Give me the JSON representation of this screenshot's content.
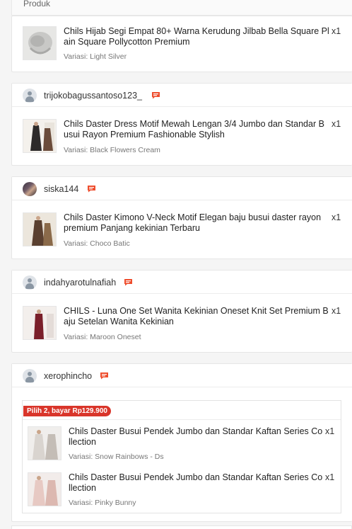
{
  "header": {
    "label": "Produk"
  },
  "orders": [
    {
      "products": [
        {
          "name_line1": "Chils Hijab Segi Empat 80+ Warna Kerudung Jilbab Bella Square Pl",
          "name_line2": "ain Square Pollycotton Premium",
          "qty": "x1",
          "variant": "Variasi: Light Silver"
        }
      ]
    },
    {
      "username": "trijokobagussantoso123_",
      "products": [
        {
          "name_line1": "Chils Daster Dress Motif Mewah Lengan 3/4 Jumbo dan Standar B",
          "name_line2": "usui Rayon Premium Fashionable Stylish",
          "qty": "x1",
          "variant": "Variasi: Black Flowers Cream"
        }
      ]
    },
    {
      "username": "siska144",
      "products": [
        {
          "name_line1": "Chils Daster Kimono V-Neck Motif Elegan baju busui daster rayon",
          "name_line2": "premium Panjang kekinian Terbaru",
          "qty": "x1",
          "variant": "Variasi: Choco Batic"
        }
      ]
    },
    {
      "username": "indahyarotulnafiah",
      "products": [
        {
          "name_line1": "CHILS - Luna One Set Wanita Kekinian Oneset Knit Set Premium B",
          "name_line2": "aju Setelan Wanita Kekinian",
          "qty": "x1",
          "variant": "Variasi: Maroon Oneset"
        }
      ]
    },
    {
      "username": "xerophincho",
      "bundle_label": "Pilih 2, bayar Rp129.900",
      "products": [
        {
          "name_line1": "Chils Daster Busui Pendek Jumbo dan Standar Kaftan Series Co",
          "name_line2": "llection",
          "qty": "x1",
          "variant": "Variasi: Snow Rainbows - Ds"
        },
        {
          "name_line1": "Chils Daster Busui Pendek Jumbo dan Standar Kaftan Series Co",
          "name_line2": "llection",
          "qty": "x1",
          "variant": "Variasi: Pinky Bunny"
        }
      ]
    }
  ],
  "colors": {
    "chat_icon": "#ee4d2d",
    "bundle_badge": "#d9352a"
  },
  "icons": {
    "chat": "chat-icon",
    "avatar": "user-avatar-icon"
  }
}
